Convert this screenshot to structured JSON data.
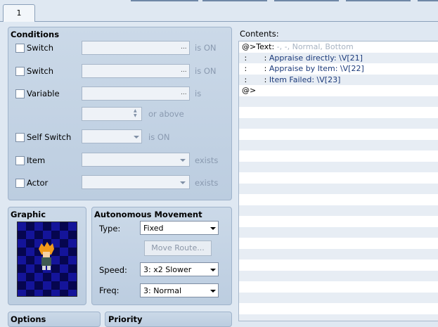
{
  "tabs": [
    {
      "label": "1"
    }
  ],
  "conditions": {
    "title": "Conditions",
    "switch1": {
      "label": "Switch",
      "dots": "...",
      "suffix": "is ON"
    },
    "switch2": {
      "label": "Switch",
      "dots": "...",
      "suffix": "is ON"
    },
    "variable": {
      "label": "Variable",
      "dots": "...",
      "suffix": "is",
      "or_above": "or above"
    },
    "self_switch": {
      "label": "Self Switch",
      "suffix": "is ON"
    },
    "item": {
      "label": "Item",
      "suffix": "exists"
    },
    "actor": {
      "label": "Actor",
      "suffix": "exists"
    }
  },
  "graphic": {
    "title": "Graphic",
    "sprite_icon": "character-sprite-icon"
  },
  "autonomous": {
    "title": "Autonomous Movement",
    "type_label": "Type:",
    "type_value": "Fixed",
    "move_route": "Move Route...",
    "speed_label": "Speed:",
    "speed_value": "3: x2 Slower",
    "freq_label": "Freq:",
    "freq_value": "3: Normal"
  },
  "options": {
    "title": "Options"
  },
  "priority": {
    "title": "Priority"
  },
  "contents": {
    "label": "Contents:",
    "lines": [
      {
        "a": "@>Text: ",
        "b": "-, -, Normal, Bottom",
        "c": ""
      },
      {
        "a": " :       : ",
        "b": "",
        "c": "Appraise directly: \\V[21]"
      },
      {
        "a": " :       : ",
        "b": "",
        "c": "Appraise by Item: \\V[22]"
      },
      {
        "a": " :       : ",
        "b": "",
        "c": "Item Failed: \\V[23]"
      },
      {
        "a": "@>",
        "b": "",
        "c": ""
      }
    ]
  },
  "colors": {
    "accent": "#1b3a7a",
    "panel": "#c4d4e6",
    "background": "#dfe8f2"
  }
}
